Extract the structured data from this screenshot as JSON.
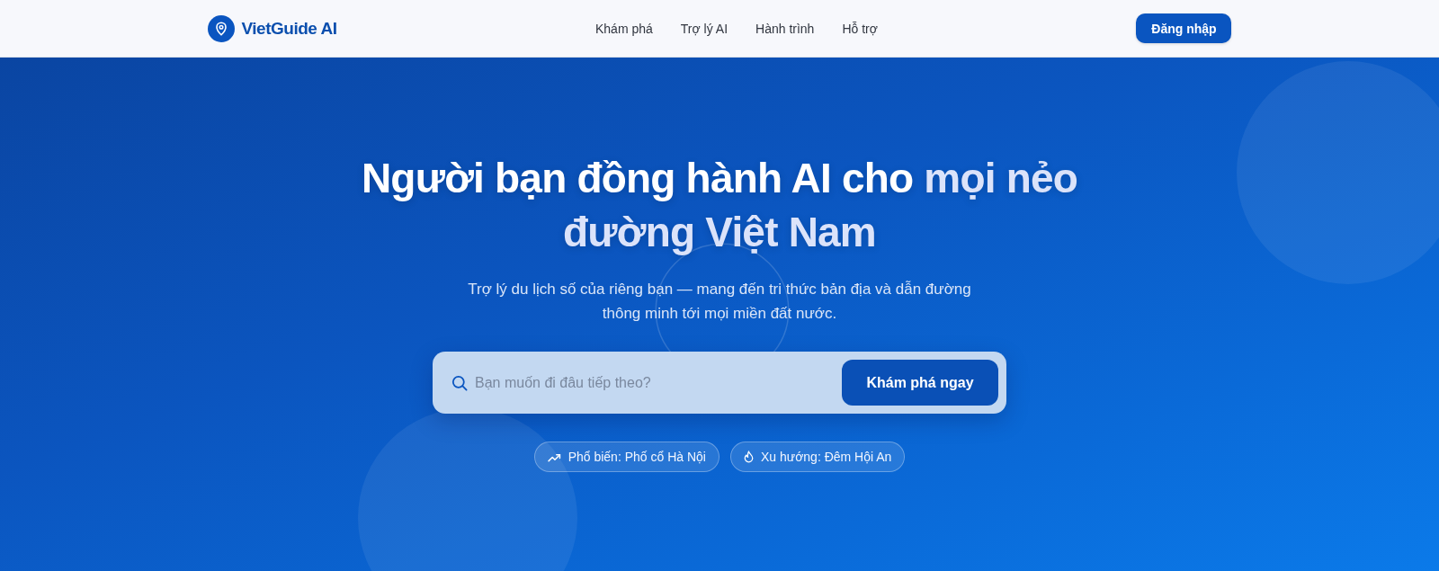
{
  "header": {
    "brand": "VietGuide AI",
    "nav": [
      {
        "label": "Khám phá"
      },
      {
        "label": "Trợ lý AI"
      },
      {
        "label": "Hành trình"
      },
      {
        "label": "Hỗ trợ"
      }
    ],
    "login_button": "Đăng nhập"
  },
  "hero": {
    "title": "Người bạn đồng hành AI cho",
    "title_highlight": "mọi nẻo đường Việt Nam",
    "subtitle": "Trợ lý du lịch số của riêng bạn — mang đến tri thức bản địa và dẫn đường thông minh tới mọi miền đất nước.",
    "search": {
      "placeholder": "Bạn muốn đi đâu tiếp theo?",
      "button": "Khám phá ngay"
    },
    "chips": [
      {
        "kind": "trending",
        "label": "Phổ biến: Phố cổ Hà Nội"
      },
      {
        "kind": "flame",
        "label": "Xu hướng: Đêm Hội An"
      }
    ]
  }
}
